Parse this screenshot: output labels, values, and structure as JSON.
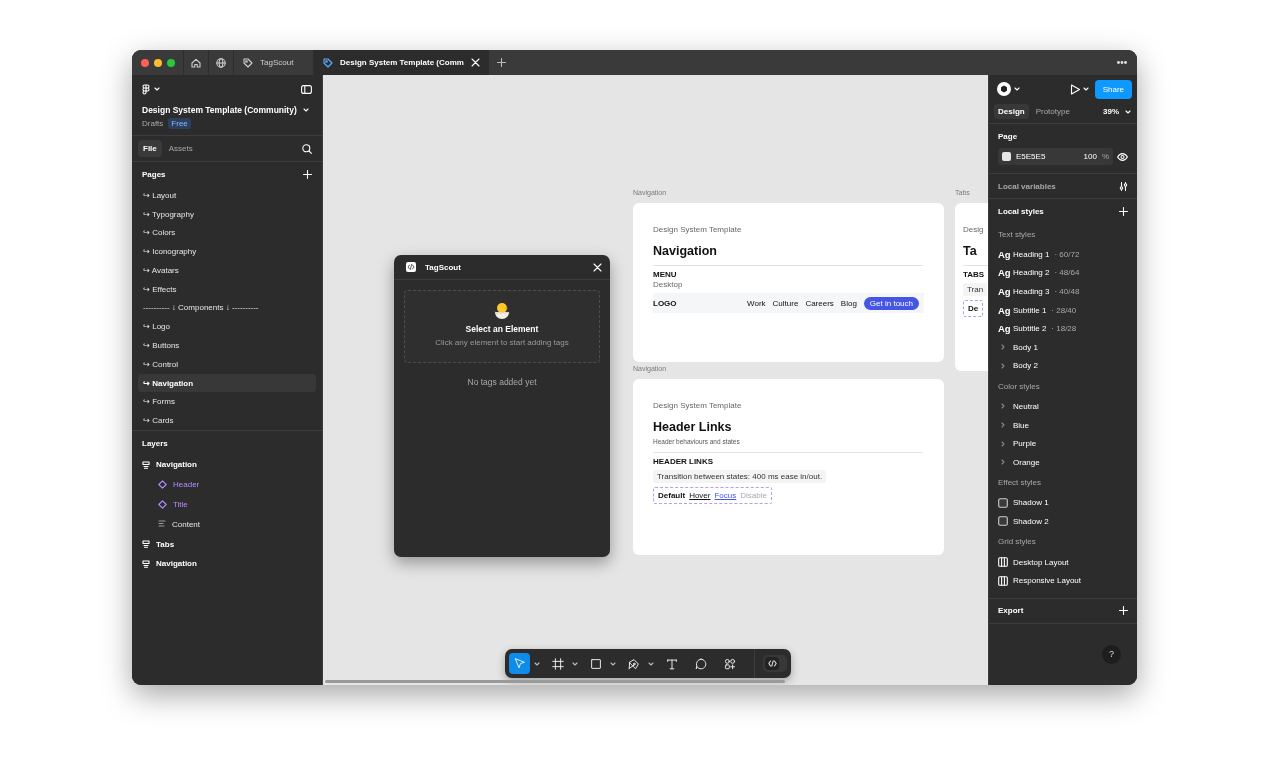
{
  "browser_tabs": [
    {
      "kind": "home",
      "selected": false
    },
    {
      "kind": "globe",
      "selected": false
    },
    {
      "kind": "file",
      "label": "TagScout",
      "selected": false
    },
    {
      "kind": "file",
      "label": "Design System Template (Comm",
      "selected": true
    }
  ],
  "file": {
    "title": "Design System Template (Community)",
    "location": "Drafts",
    "plan": "Free"
  },
  "panel_tabs": [
    {
      "label": "File",
      "selected": true
    },
    {
      "label": "Assets",
      "selected": false
    }
  ],
  "pages": {
    "title": "Pages",
    "items": [
      {
        "label": "↪ Layout",
        "selected": false
      },
      {
        "label": "↪ Typography",
        "selected": false
      },
      {
        "label": "↪ Colors",
        "selected": false
      },
      {
        "label": "↪ Iconography",
        "selected": false
      },
      {
        "label": "↪ Avatars",
        "selected": false
      },
      {
        "label": "↪ Effects",
        "selected": false
      },
      {
        "label": "---------- ↓ Components ↓ ----------",
        "selected": false
      },
      {
        "label": "↪ Logo",
        "selected": false
      },
      {
        "label": "↪ Buttons",
        "selected": false
      },
      {
        "label": "↪ Control",
        "selected": false
      },
      {
        "label": "↪ Navigation",
        "selected": true
      },
      {
        "label": "↪ Forms",
        "selected": false
      },
      {
        "label": "↪ Cards",
        "selected": false
      }
    ]
  },
  "layers": {
    "title": "Layers",
    "items": [
      {
        "label": "Navigation",
        "kind": "section",
        "children": [
          {
            "label": "Header",
            "kind": "component"
          },
          {
            "label": "Title",
            "kind": "component"
          },
          {
            "label": "Content",
            "kind": "frame"
          }
        ]
      },
      {
        "label": "Tabs",
        "kind": "section"
      },
      {
        "label": "Navigation",
        "kind": "section"
      }
    ]
  },
  "canvas": {
    "frames": [
      {
        "label": "Navigation",
        "eyebrow": "Design System Template",
        "heading": "Navigation",
        "section": "MENU",
        "subsection": "Desktop",
        "navbar": {
          "logo": "LOGO",
          "links": [
            "Work",
            "Culture",
            "Careers",
            "Blog"
          ],
          "cta": "Get in touch"
        }
      },
      {
        "label": "Navigation",
        "eyebrow": "Design System Template",
        "heading": "Header Links",
        "subtitle": "Header behaviours and states",
        "section": "HEADER LINKS",
        "note": "Transition between states: 400 ms ease in/out.",
        "states": [
          {
            "label": "Default",
            "kind": "default"
          },
          {
            "label": "Hover",
            "kind": "hover"
          },
          {
            "label": "Focus",
            "kind": "focus"
          },
          {
            "label": "Disable",
            "kind": "disabled"
          }
        ]
      },
      {
        "label": "Tabs",
        "eyebrow": "Desig",
        "heading": "Ta",
        "section": "TABS",
        "note": "Tran",
        "states": [
          {
            "label": "De",
            "kind": "default"
          }
        ]
      }
    ]
  },
  "plugin": {
    "title": "TagScout",
    "prompt_title": "Select an Element",
    "prompt_text": "Click any element to start adding tags",
    "empty_text": "No tags added yet"
  },
  "toolbar": [
    {
      "kind": "move",
      "selected": true,
      "menu": true
    },
    {
      "kind": "frame",
      "selected": false,
      "menu": true
    },
    {
      "kind": "rectangle",
      "selected": false,
      "menu": true
    },
    {
      "kind": "pen",
      "selected": false,
      "menu": true
    },
    {
      "kind": "text",
      "selected": false,
      "menu": false
    },
    {
      "kind": "comment",
      "selected": false,
      "menu": false
    },
    {
      "kind": "actions",
      "selected": false,
      "menu": false
    }
  ],
  "dev_mode": {
    "on": false
  },
  "right_panel": {
    "share": "Share",
    "tabs": [
      {
        "label": "Design",
        "selected": true
      },
      {
        "label": "Prototype",
        "selected": false
      }
    ],
    "zoom": "39%",
    "page": {
      "title": "Page",
      "color": "E5E5E5",
      "opacity": "100",
      "unit": "%"
    },
    "local_variables": "Local variables",
    "local_styles": "Local styles",
    "style_groups": [
      {
        "title": "Text styles",
        "items": [
          {
            "kind": "text",
            "sample": "Ag",
            "name": "Heading 1",
            "meta": "· 60/72"
          },
          {
            "kind": "text",
            "sample": "Ag",
            "name": "Heading 2",
            "meta": "· 48/64"
          },
          {
            "kind": "text",
            "sample": "Ag",
            "name": "Heading 3",
            "meta": "· 40/48"
          },
          {
            "kind": "text",
            "sample": "Ag",
            "name": "Subtitle 1",
            "meta": "· 28/40"
          },
          {
            "kind": "text",
            "sample": "Ag",
            "name": "Subtitle 2",
            "meta": "· 18/28"
          },
          {
            "kind": "folder",
            "name": "Body 1"
          },
          {
            "kind": "folder",
            "name": "Body 2"
          }
        ]
      },
      {
        "title": "Color styles",
        "items": [
          {
            "kind": "folder",
            "name": "Neutral"
          },
          {
            "kind": "folder",
            "name": "Blue"
          },
          {
            "kind": "folder",
            "name": "Purple"
          },
          {
            "kind": "folder",
            "name": "Orange"
          }
        ]
      },
      {
        "title": "Effect styles",
        "items": [
          {
            "kind": "effect",
            "name": "Shadow 1"
          },
          {
            "kind": "effect",
            "name": "Shadow 2"
          }
        ]
      },
      {
        "title": "Grid styles",
        "items": [
          {
            "kind": "grid",
            "name": "Desktop Layout"
          },
          {
            "kind": "grid",
            "name": "Responsive Layout"
          }
        ]
      }
    ],
    "export": "Export",
    "help": "?"
  }
}
